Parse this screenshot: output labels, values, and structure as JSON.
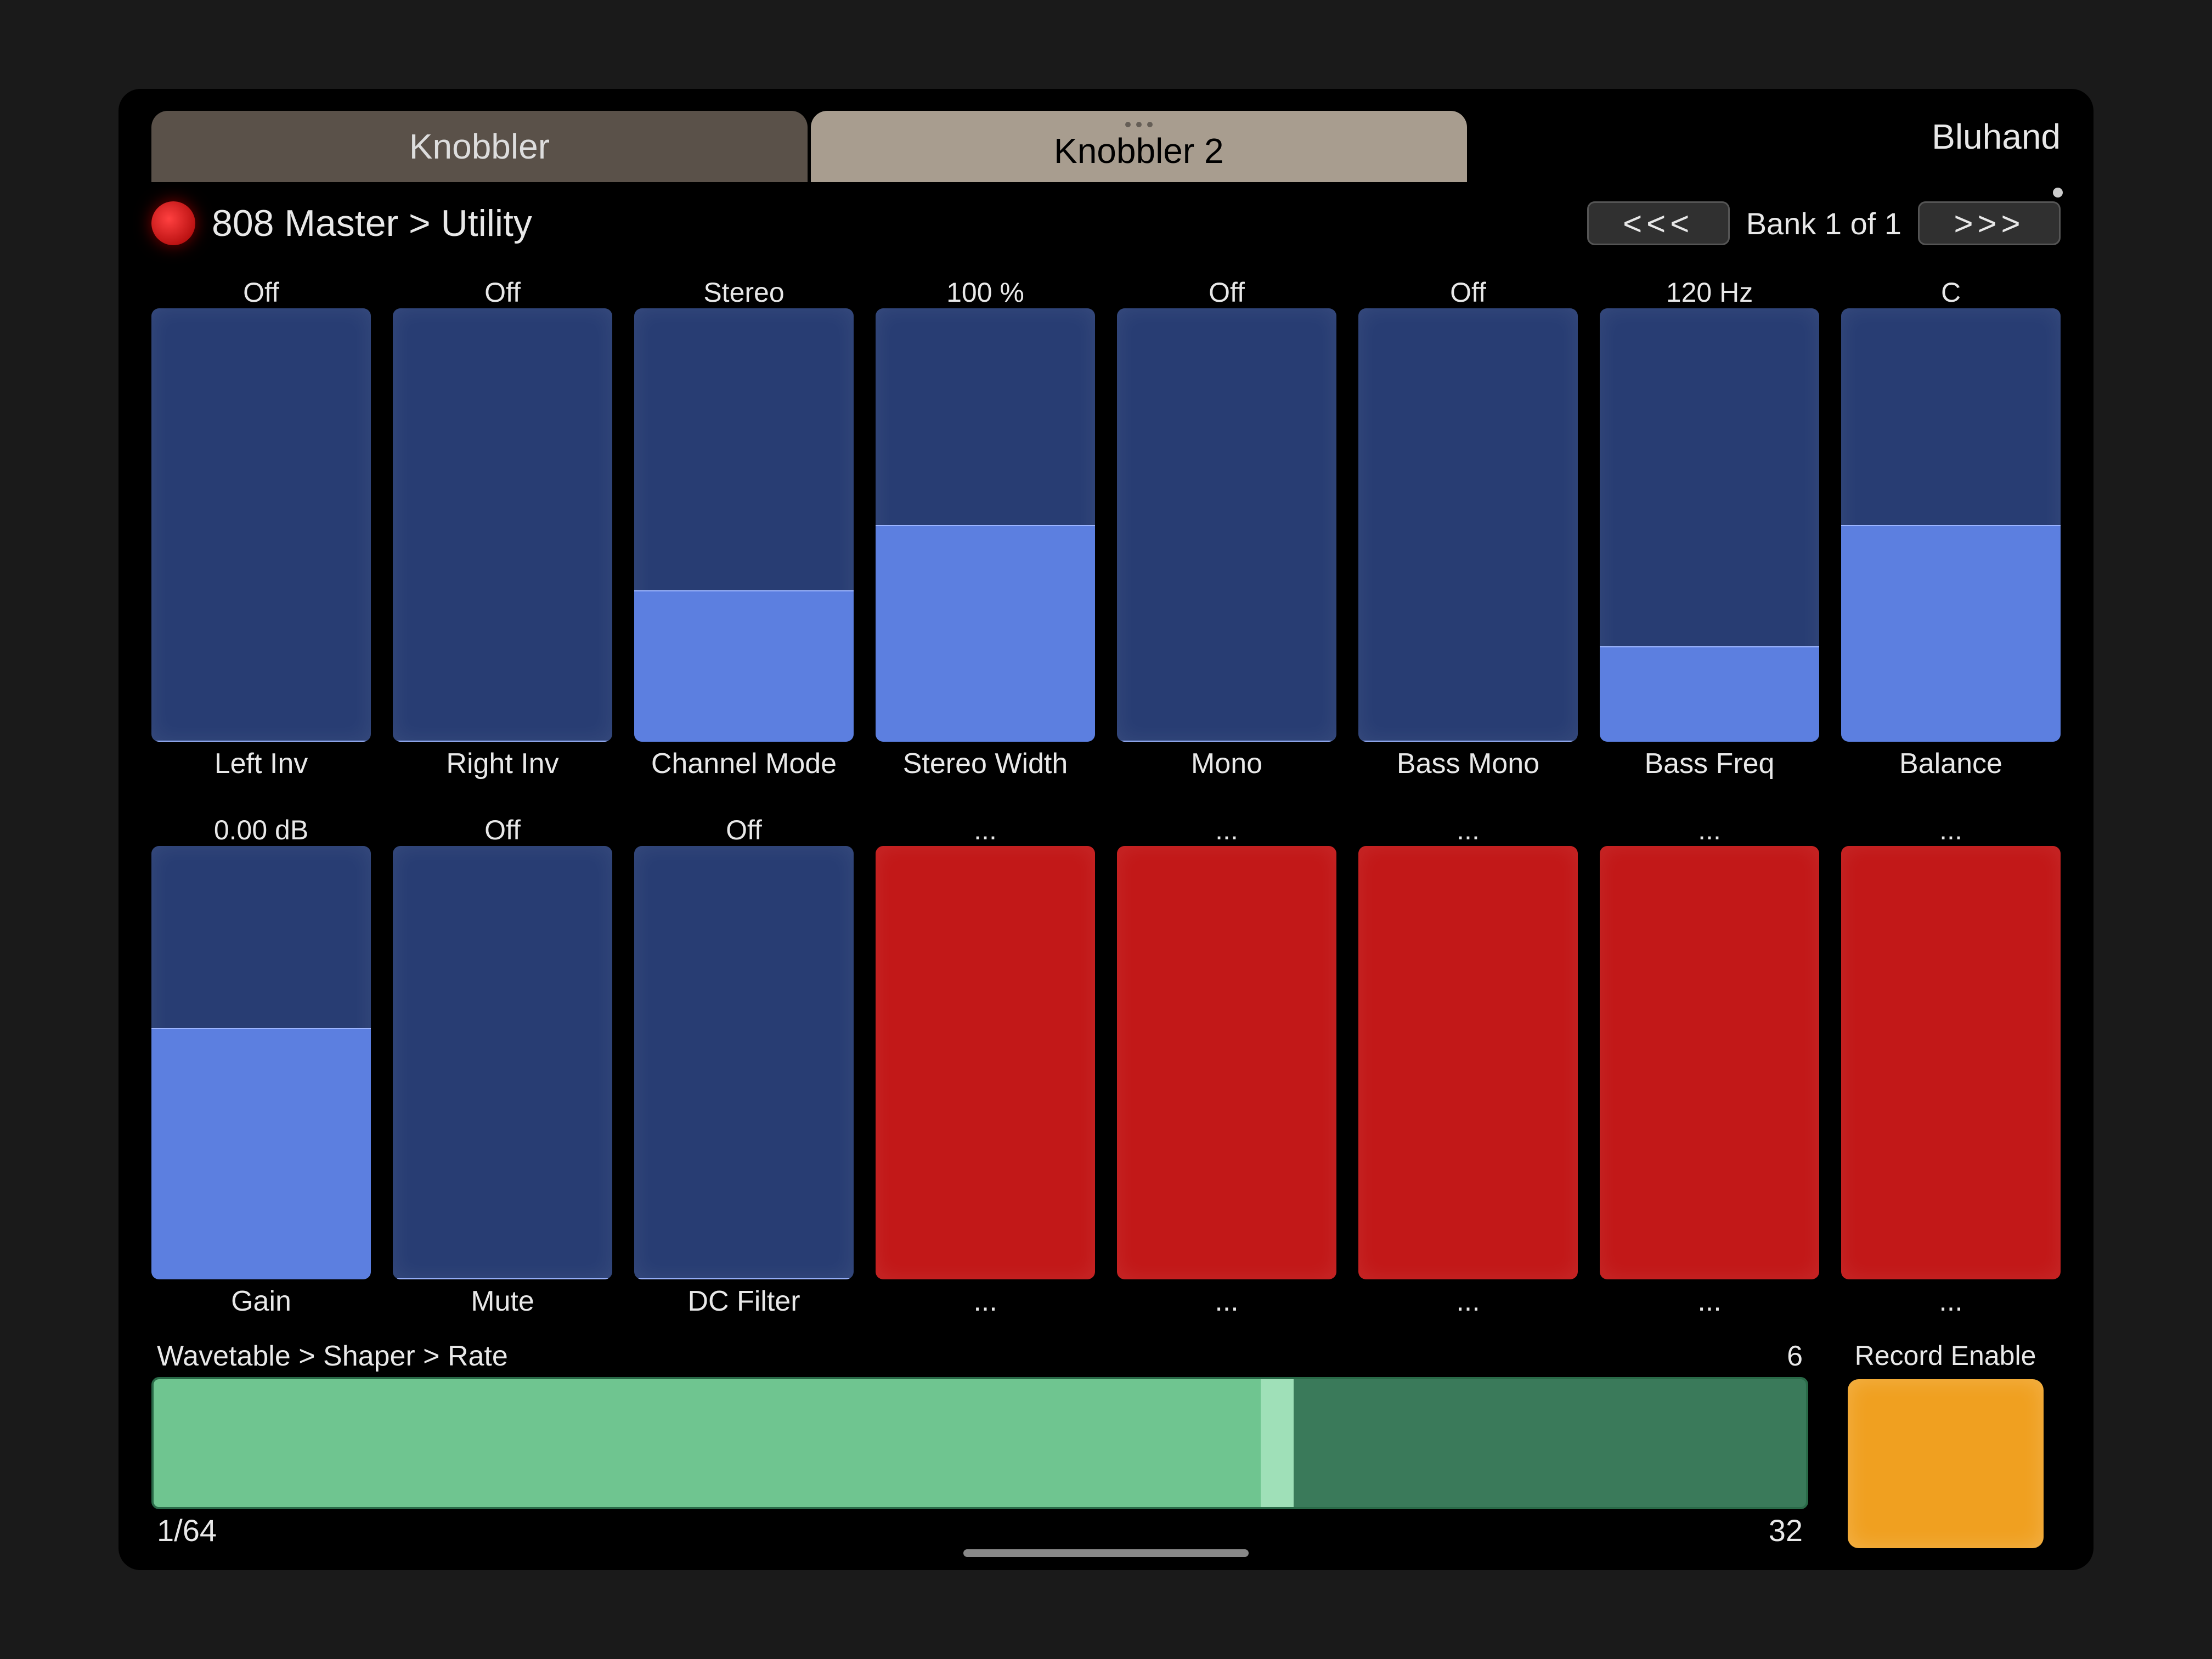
{
  "tabs": {
    "left": "Knobbler",
    "center": "Knobbler 2",
    "right": "Bluhand"
  },
  "breadcrumb": "808 Master > Utility",
  "bank": {
    "prev": "<<<",
    "label": "Bank 1 of 1",
    "next": ">>>"
  },
  "sliders": [
    {
      "value": "Off",
      "name": "Left Inv",
      "color": "blue",
      "fill": 0
    },
    {
      "value": "Off",
      "name": "Right Inv",
      "color": "blue",
      "fill": 0
    },
    {
      "value": "Stereo",
      "name": "Channel Mode",
      "color": "blue",
      "fill": 35
    },
    {
      "value": "100 %",
      "name": "Stereo Width",
      "color": "blue",
      "fill": 50
    },
    {
      "value": "Off",
      "name": "Mono",
      "color": "blue",
      "fill": 0
    },
    {
      "value": "Off",
      "name": "Bass Mono",
      "color": "blue",
      "fill": 0
    },
    {
      "value": "120 Hz",
      "name": "Bass Freq",
      "color": "blue",
      "fill": 22
    },
    {
      "value": "C",
      "name": "Balance",
      "color": "blue",
      "fill": 50
    },
    {
      "value": "0.00 dB",
      "name": "Gain",
      "color": "blue",
      "fill": 58
    },
    {
      "value": "Off",
      "name": "Mute",
      "color": "blue",
      "fill": 0
    },
    {
      "value": "Off",
      "name": "DC Filter",
      "color": "blue",
      "fill": 0
    },
    {
      "value": "...",
      "name": "...",
      "color": "red",
      "fill": 0
    },
    {
      "value": "...",
      "name": "...",
      "color": "red",
      "fill": 0
    },
    {
      "value": "...",
      "name": "...",
      "color": "red",
      "fill": 0
    },
    {
      "value": "...",
      "name": "...",
      "color": "red",
      "fill": 0
    },
    {
      "value": "...",
      "name": "...",
      "color": "red",
      "fill": 0
    }
  ],
  "hslider": {
    "label": "Wavetable > Shaper > Rate",
    "value": "6",
    "min": "1/64",
    "max": "32",
    "fill_pct": 68
  },
  "record_enable": "Record Enable"
}
